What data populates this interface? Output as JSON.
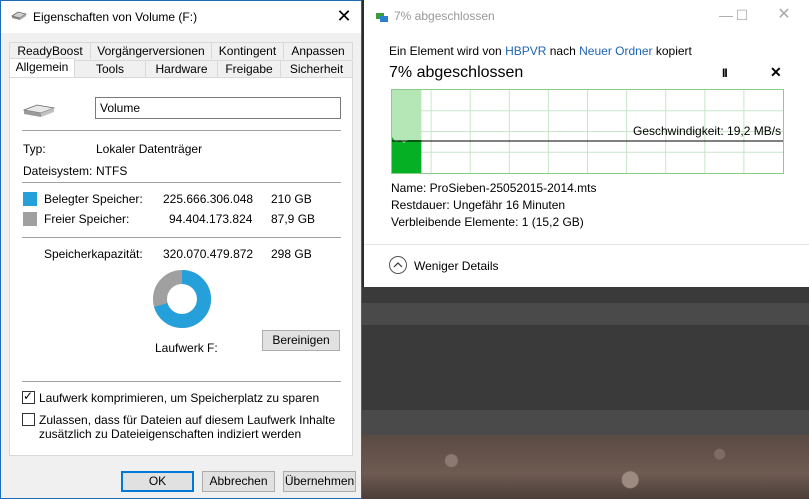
{
  "properties": {
    "title": "Eigenschaften von Volume (F:)",
    "tabs_row1": [
      "ReadyBoost",
      "Vorgängerversionen",
      "Kontingent",
      "Anpassen"
    ],
    "tabs_row2": [
      "Allgemein",
      "Tools",
      "Hardware",
      "Freigabe",
      "Sicherheit"
    ],
    "volume_name": "Volume",
    "type_label": "Typ:",
    "type_value": "Lokaler Datenträger",
    "fs_label": "Dateisystem:",
    "fs_value": "NTFS",
    "used_label": "Belegter Speicher:",
    "used_bytes": "225.666.306.048",
    "used_gb": "210 GB",
    "free_label": "Freier Speicher:",
    "free_bytes": "94.404.173.824",
    "free_gb": "87,9 GB",
    "capacity_label": "Speicherkapazität:",
    "capacity_bytes": "320.070.479.872",
    "capacity_gb": "298 GB",
    "drive_label": "Laufwerk F:",
    "cleanup_button": "Bereinigen",
    "compress_label": "Laufwerk komprimieren, um Speicherplatz zu sparen",
    "compress_checked": true,
    "index_label_line1": "Zulassen, dass für Dateien auf diesem Laufwerk Inhalte",
    "index_label_line2": "zusätzlich zu Dateieigenschaften indiziert werden",
    "index_checked": false,
    "ok_button": "OK",
    "cancel_button": "Abbrechen",
    "apply_button": "Übernehmen",
    "used_fraction": 0.705,
    "colors": {
      "used": "#26a0da",
      "free": "#a0a0a0",
      "accent": "#0078d7"
    }
  },
  "copy": {
    "title": "7% abgeschlossen",
    "header_prefix": "Ein Element wird von",
    "source": "HBPVR",
    "header_middle": "nach",
    "destination": "Neuer Ordner",
    "header_suffix": "kopiert",
    "progress_text": "7% abgeschlossen",
    "progress_fraction": 0.07,
    "speed_label": "Geschwindigkeit: 19,2 MB/s",
    "name_line": "Name:  ProSieben-25052015-2014.mts",
    "remaining_line": "Restdauer:  Ungefähr 16 Minuten",
    "items_line": "Verbleibende Elemente:  1 (15,2 GB)",
    "less_details": "Weniger Details",
    "pause_glyph": "II",
    "close_glyph": "✕",
    "colors": {
      "graph_fill": "#06b025",
      "graph_grid": "#c8e6c8",
      "link": "#1e64b4"
    }
  }
}
